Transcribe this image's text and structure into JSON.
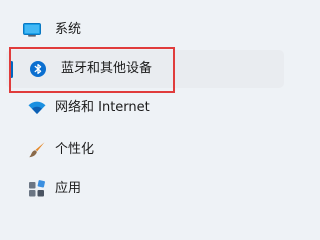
{
  "nav": {
    "items": [
      {
        "label": "系统",
        "icon": "monitor-icon"
      },
      {
        "label": "蓝牙和其他设备",
        "icon": "bluetooth-icon",
        "selected": true
      },
      {
        "label": "网络和 Internet",
        "icon": "wifi-icon"
      },
      {
        "label": "个性化",
        "icon": "paintbrush-icon"
      },
      {
        "label": "应用",
        "icon": "apps-icon"
      }
    ]
  },
  "colors": {
    "accent": "#0067c0",
    "highlight_border": "#e03c3c",
    "background": "#eef2f6",
    "selected_background": "#e9ecf0"
  }
}
